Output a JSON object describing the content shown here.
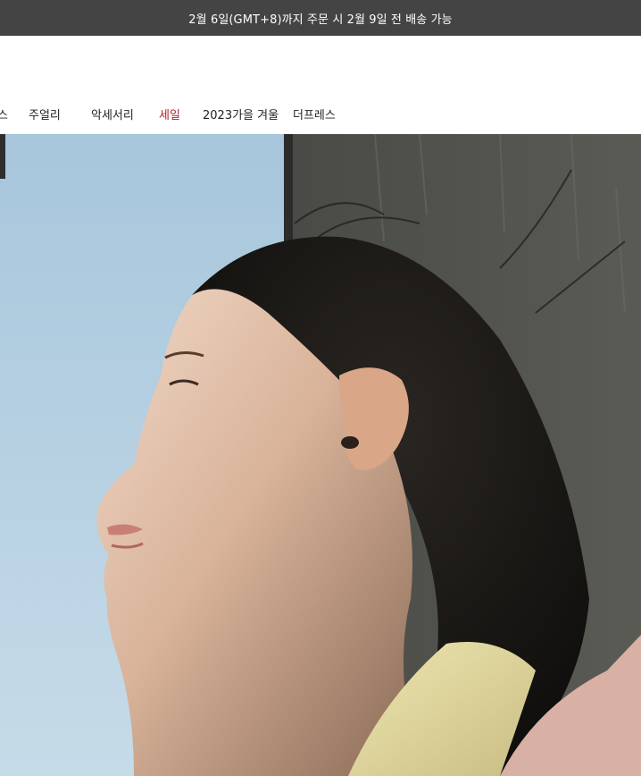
{
  "announcement": {
    "text": "2월 6일(GMT+8)까지 주문 시 2월 9일 전 배송 가능"
  },
  "nav": {
    "items": [
      {
        "label": "스"
      },
      {
        "label": "주얼리"
      },
      {
        "label": "악세서리"
      },
      {
        "label": "세일"
      },
      {
        "label": "2023가을 겨울"
      },
      {
        "label": "더프레스"
      }
    ]
  },
  "colors": {
    "announcement_bg": "#444444",
    "sale_accent": "#b0202a",
    "sky": "#a9c9df"
  },
  "hero": {
    "media": "video-still-woman-looking-out-window"
  }
}
